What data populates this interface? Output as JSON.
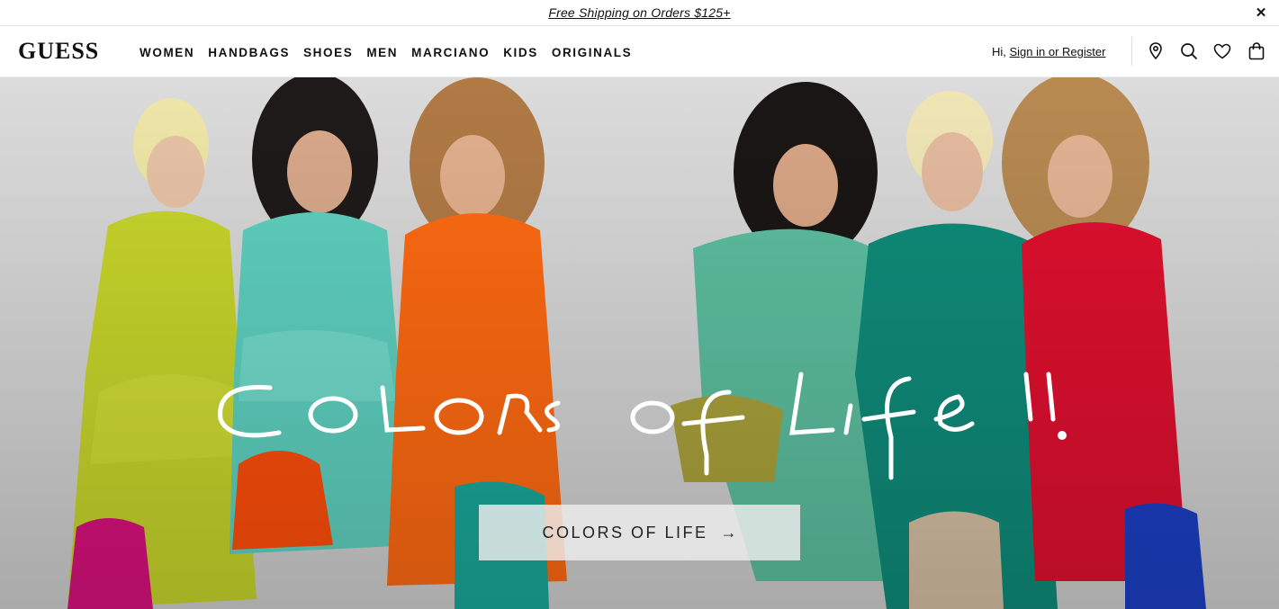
{
  "promo": {
    "text": "Free Shipping on Orders $125+",
    "close_icon": "close-icon"
  },
  "header": {
    "logo": "GUESS",
    "nav": [
      "WOMEN",
      "HANDBAGS",
      "SHOES",
      "MEN",
      "MARCIANO",
      "KIDS",
      "ORIGINALS"
    ],
    "greeting": "Hi, ",
    "signin": "Sign in or Register",
    "icons": [
      "store-locator-icon",
      "search-icon",
      "heart-icon",
      "shopping-bag-icon"
    ]
  },
  "hero": {
    "script_title": "Colors of Life !!",
    "cta_label": "COLORS OF LIFE",
    "cta_arrow": "→",
    "colors": {
      "lime": "#c8d62b",
      "aqua": "#5fd1c0",
      "orange": "#ff6a12",
      "mint": "#5dbf9f",
      "teal": "#0f8c7a",
      "red": "#e0102f"
    }
  }
}
